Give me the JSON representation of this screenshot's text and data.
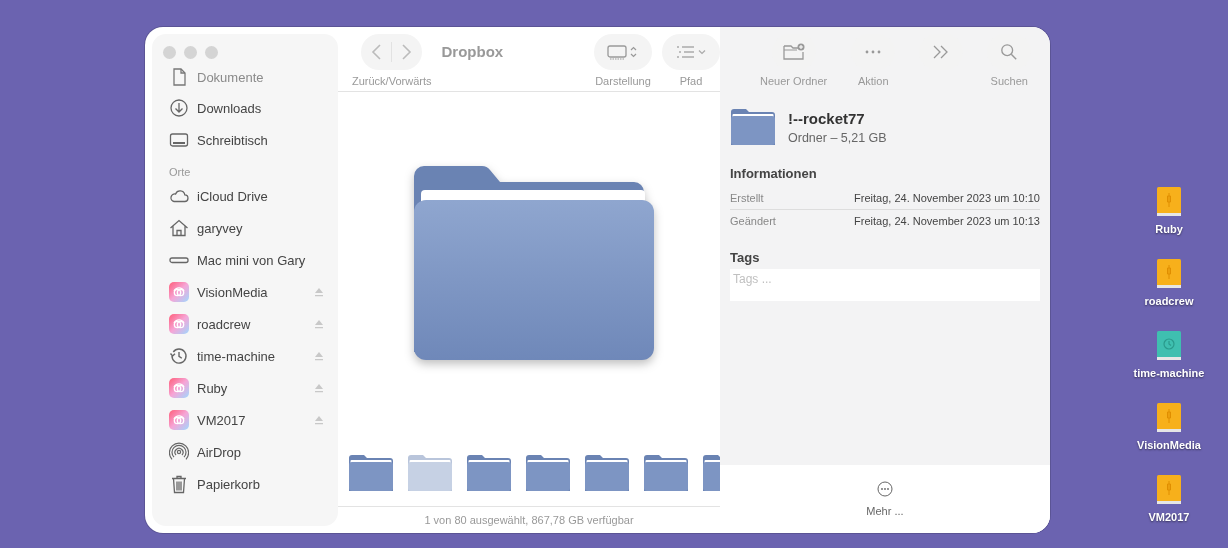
{
  "window": {
    "title": "Dropbox"
  },
  "toolbar": {
    "nav_label": "Zurück/Vorwärts",
    "items": [
      {
        "kind": "view",
        "label": "Darstellung"
      },
      {
        "kind": "path",
        "label": "Pfad"
      },
      {
        "kind": "newfolder",
        "label": "Neuer Ordner"
      },
      {
        "kind": "action",
        "label": "Aktion"
      },
      {
        "kind": "more"
      },
      {
        "kind": "search",
        "label": "Suchen"
      }
    ]
  },
  "sidebar": {
    "items": [
      {
        "kind": "document",
        "label": "Dokumente",
        "ejectable": false
      },
      {
        "kind": "download",
        "label": "Downloads",
        "ejectable": false
      },
      {
        "kind": "desktop",
        "label": "Schreibtisch",
        "ejectable": false
      }
    ],
    "section": "Orte",
    "places": [
      {
        "kind": "cloud",
        "label": "iCloud Drive",
        "ejectable": false
      },
      {
        "kind": "home",
        "label": "garyvey",
        "ejectable": false
      },
      {
        "kind": "computer",
        "label": "Mac mini von Gary",
        "ejectable": false
      },
      {
        "kind": "volume",
        "label": "VisionMedia",
        "ejectable": true
      },
      {
        "kind": "volume",
        "label": "roadcrew",
        "ejectable": true
      },
      {
        "kind": "timemachine",
        "label": "time-machine",
        "ejectable": true
      },
      {
        "kind": "volume",
        "label": "Ruby",
        "ejectable": true
      },
      {
        "kind": "volume",
        "label": "VM2017",
        "ejectable": true
      },
      {
        "kind": "airdrop",
        "label": "AirDrop",
        "ejectable": false
      },
      {
        "kind": "trash",
        "label": "Papierkorb",
        "ejectable": false
      }
    ]
  },
  "thumbnails": [
    {
      "dimmed": false
    },
    {
      "dimmed": true
    },
    {
      "dimmed": false
    },
    {
      "dimmed": false
    },
    {
      "dimmed": false
    },
    {
      "dimmed": false
    },
    {
      "dimmed": false
    }
  ],
  "status_bar": "1 von 80 ausgewählt, 867,78 GB verfügbar",
  "inspector": {
    "name": "!--rocket77",
    "subtitle": "Ordner – 5,21 GB",
    "info_heading": "Informationen",
    "info": [
      {
        "label": "Erstellt",
        "value": "Freitag, 24. November 2023 um 10:10"
      },
      {
        "label": "Geändert",
        "value": "Freitag, 24. November 2023 um 10:13"
      }
    ],
    "tags_heading": "Tags",
    "tags_placeholder": "Tags ...",
    "more_label": "Mehr ..."
  },
  "desktop_icons": [
    {
      "kind": "drive",
      "label": "Ruby"
    },
    {
      "kind": "drive",
      "label": "roadcrew"
    },
    {
      "kind": "timemachine",
      "label": "time-machine"
    },
    {
      "kind": "drive",
      "label": "VisionMedia"
    },
    {
      "kind": "drive",
      "label": "VM2017"
    }
  ]
}
